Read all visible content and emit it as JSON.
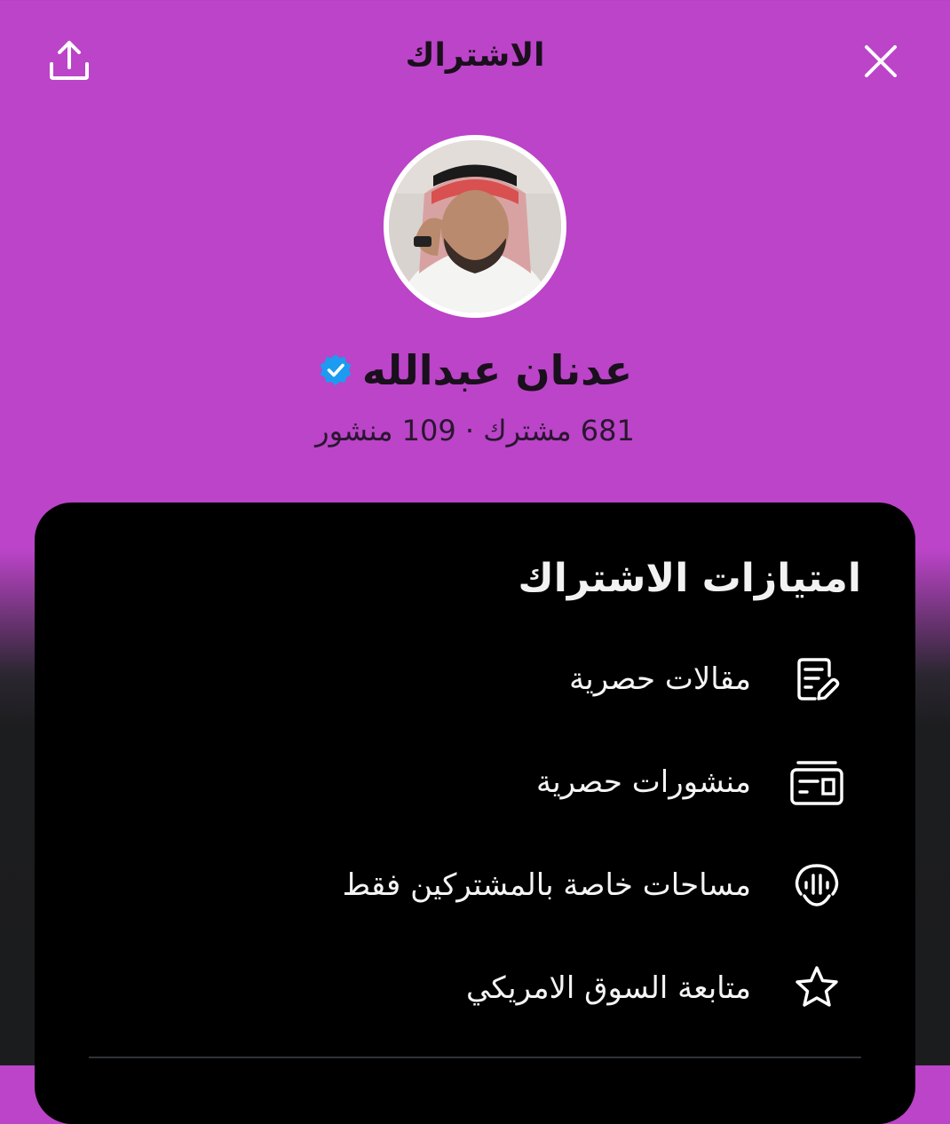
{
  "header": {
    "title": "الاشتراك",
    "close_icon": "close-icon",
    "share_icon": "share-icon"
  },
  "profile": {
    "name": "عدنان عبدالله",
    "verified": true,
    "stats": "681 مشترك · 109 منشور",
    "avatar_alt": "profile photo"
  },
  "benefits": {
    "title": "امتيازات الاشتراك",
    "items": [
      {
        "label": "مقالات حصرية",
        "icon": "article-icon"
      },
      {
        "label": "منشورات حصرية",
        "icon": "posts-icon"
      },
      {
        "label": "مساحات خاصة بالمشتركين فقط",
        "icon": "spaces-icon"
      },
      {
        "label": "متابعة السوق الامريكي",
        "icon": "star-icon"
      }
    ]
  },
  "colors": {
    "header_bg": "#bb44c8",
    "card_bg": "#000000",
    "verified_blue": "#1d9bf0"
  }
}
